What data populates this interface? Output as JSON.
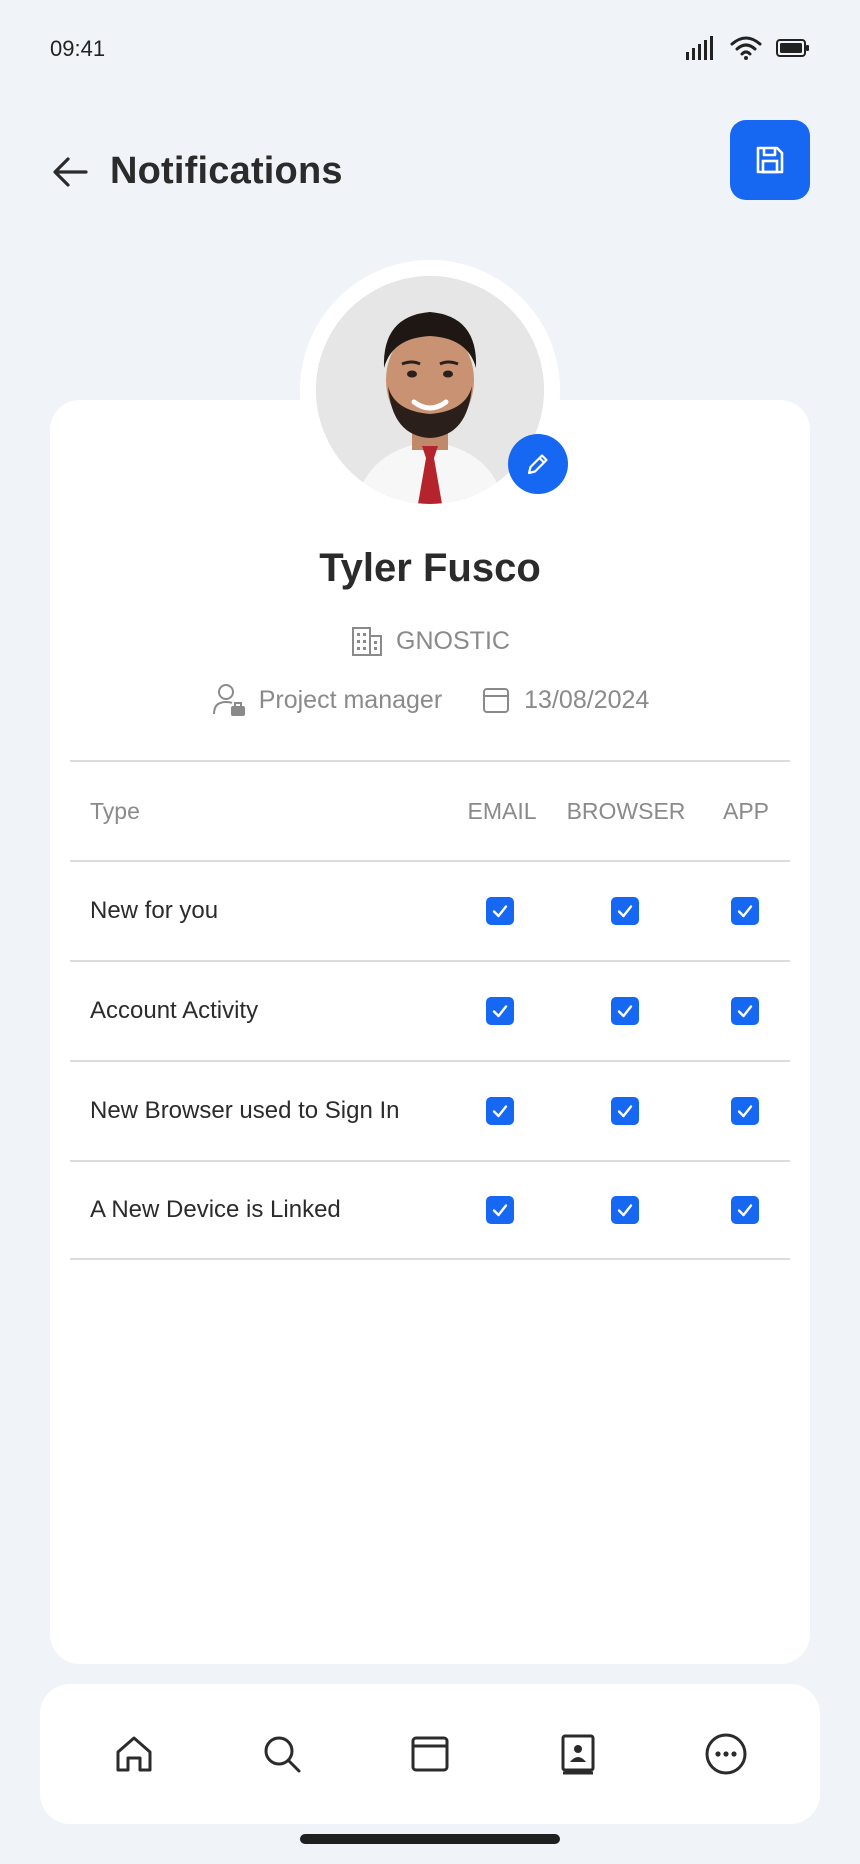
{
  "status_bar": {
    "time": "09:41"
  },
  "header": {
    "title": "Notifications"
  },
  "profile": {
    "name": "Tyler Fusco",
    "company": "GNOSTIC",
    "role": "Project manager",
    "date": "13/08/2024"
  },
  "table": {
    "headers": {
      "type": "Type",
      "email": "EMAIL",
      "browser": "BROWSER",
      "app": "APP"
    },
    "rows": [
      {
        "type": "New for you",
        "email": true,
        "browser": true,
        "app": true
      },
      {
        "type": "Account Activity",
        "email": true,
        "browser": true,
        "app": true
      },
      {
        "type": "New Browser used to Sign In",
        "email": true,
        "browser": true,
        "app": true
      },
      {
        "type": "A New Device is Linked",
        "email": true,
        "browser": true,
        "app": true
      }
    ]
  },
  "bottom_nav": {
    "items": [
      "home-icon",
      "search-icon",
      "window-icon",
      "contacts-icon",
      "more-icon"
    ]
  },
  "colors": {
    "accent": "#1667f2",
    "background": "#f0f4f9",
    "card": "#ffffff"
  }
}
